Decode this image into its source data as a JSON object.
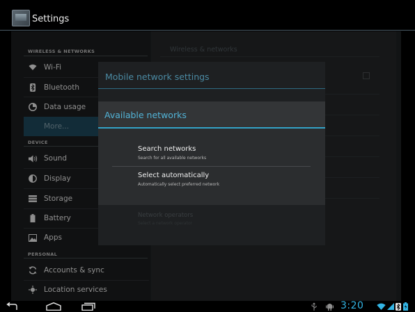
{
  "app": {
    "title": "Settings"
  },
  "sidebar": {
    "sections": [
      {
        "header": "WIRELESS & NETWORKS"
      },
      {
        "header": "DEVICE"
      },
      {
        "header": "PERSONAL"
      }
    ],
    "items": [
      {
        "label": "Wi-Fi",
        "icon": "wifi-icon"
      },
      {
        "label": "Bluetooth",
        "icon": "bluetooth-icon"
      },
      {
        "label": "Data usage",
        "icon": "data-usage-icon"
      },
      {
        "label": "More...",
        "icon": "",
        "selected": true
      },
      {
        "label": "Sound",
        "icon": "speaker-icon"
      },
      {
        "label": "Display",
        "icon": "display-icon"
      },
      {
        "label": "Storage",
        "icon": "storage-icon"
      },
      {
        "label": "Battery",
        "icon": "battery-icon"
      },
      {
        "label": "Apps",
        "icon": "apps-icon"
      },
      {
        "label": "Accounts & sync",
        "icon": "sync-icon"
      },
      {
        "label": "Location services",
        "icon": "location-icon"
      }
    ]
  },
  "background_panel": {
    "title": "Wireless & networks",
    "operators_title": "Network operators",
    "operators_sub": "Select a network operator"
  },
  "mobile_dialog": {
    "title": "Mobile network settings"
  },
  "networks_dialog": {
    "title": "Available networks",
    "options": [
      {
        "title": "Search networks",
        "subtitle": "Search for all available networks"
      },
      {
        "title": "Select automatically",
        "subtitle": "Automatically select preferred network"
      }
    ]
  },
  "system_bar": {
    "time": "3:20",
    "accent_color": "#33b5e5"
  }
}
